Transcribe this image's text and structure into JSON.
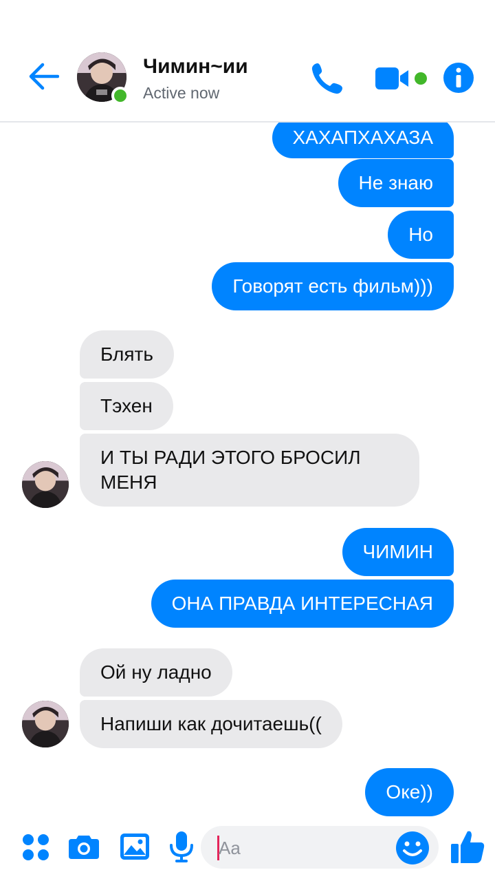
{
  "header": {
    "contact_name": "Чимин~ии",
    "status": "Active now",
    "icons": [
      "back-arrow-icon",
      "phone-icon",
      "video-camera-icon",
      "info-icon"
    ]
  },
  "colors": {
    "accent": "#0084ff",
    "incoming_bubble": "#e9e9eb",
    "online": "#42b72a"
  },
  "messages": [
    {
      "sender": "me",
      "text": "ХАХАПХАХАЗА"
    },
    {
      "sender": "me",
      "text": "Не знаю"
    },
    {
      "sender": "me",
      "text": "Но"
    },
    {
      "sender": "me",
      "text": "Говорят есть фильм)))"
    },
    {
      "sender": "contact",
      "text": "Блять"
    },
    {
      "sender": "contact",
      "text": "Тэхен"
    },
    {
      "sender": "contact",
      "text": "И ТЫ РАДИ ЭТОГО БРОСИЛ МЕНЯ"
    },
    {
      "sender": "me",
      "text": "ЧИМИН"
    },
    {
      "sender": "me",
      "text": "ОНА ПРАВДА ИНТЕРЕСНАЯ"
    },
    {
      "sender": "contact",
      "text": "Ой ну ладно"
    },
    {
      "sender": "contact",
      "text": "Напиши как дочитаешь(("
    },
    {
      "sender": "me",
      "text": "Оке))"
    }
  ],
  "composer": {
    "placeholder": "Aa",
    "icons": [
      "menu-dots-icon",
      "camera-icon",
      "gallery-icon",
      "microphone-icon",
      "emoji-icon",
      "thumbs-up-icon"
    ]
  }
}
